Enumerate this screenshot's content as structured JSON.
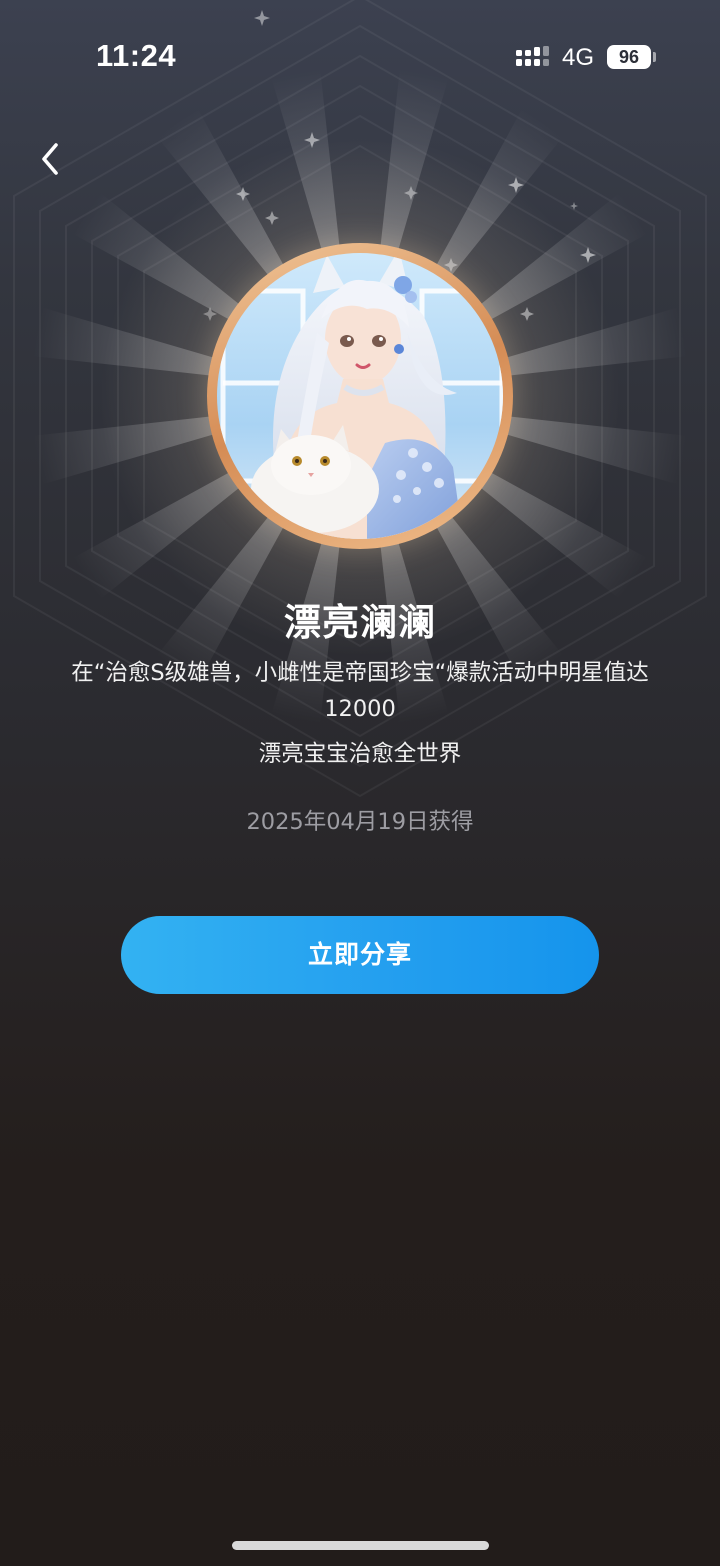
{
  "status_bar": {
    "time": "11:24",
    "network": "4G",
    "battery": "96"
  },
  "icons": {
    "back": "chevron-left-icon",
    "signal": "cellular-signal-icon",
    "battery": "battery-icon"
  },
  "badge": {
    "title": "漂亮澜澜",
    "description": "在“治愈S级雄兽，小雌性是帝国珍宝“爆款活动中明星值达12000",
    "subtitle": "漂亮宝宝治愈全世界",
    "obtained_date": "2025年04月19日获得"
  },
  "actions": {
    "share_label": "立即分享"
  },
  "colors": {
    "background_top": "#3c4150",
    "background_bottom": "#221c1a",
    "share_button": "#249fef",
    "ring": "#d58c55",
    "date_text": "#9d9da3"
  }
}
